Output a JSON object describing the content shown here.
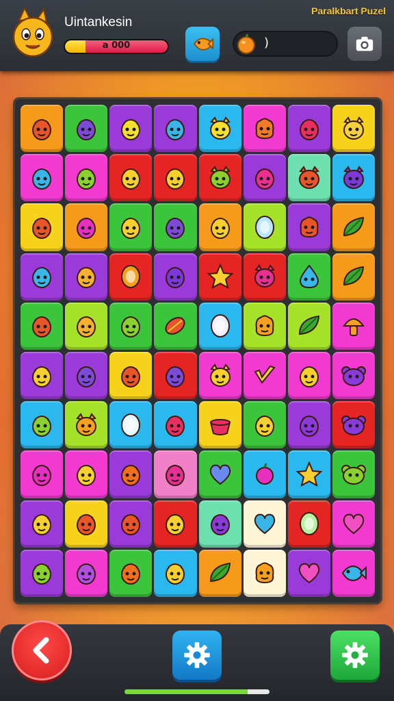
{
  "header": {
    "player_name": "Uintankesin",
    "score": "a 000",
    "score_progress": 0.2,
    "timer": ")",
    "game_title": "Paralkbart Puzel"
  },
  "icons": {
    "mascot": "cat-mascot-icon",
    "fish_button": "fish-icon",
    "timer": "fruit-timer-icon",
    "camera": "camera-icon",
    "back": "chevron-left-icon",
    "settings_blue": "gear-icon",
    "settings_green": "gear-icon"
  },
  "colors": {
    "topbar": "#2b2f35",
    "board": "#2e2f33",
    "accent_red": "#e02020",
    "accent_blue": "#1d8fd0",
    "accent_green": "#1ea83a"
  },
  "board": {
    "rows": 10,
    "cols": 8,
    "tiles": [
      [
        "orange:face:#e8552a",
        "green:face:#7b4bd8",
        "purple:face:#f2e030",
        "purple:face:#3ab5e8",
        "cyan:cat:#f5e030",
        "pink:blob:#f07a2a",
        "purple:face:#e83060",
        "yellow:cat:#f5d040"
      ],
      [
        "pink:face:#3ab5e8",
        "pink:face:#8ad030",
        "red:face:#f5d030",
        "red:face:#f5d030",
        "red:cat:#8ad030",
        "purple:face:#e83090",
        "mint:cat:#e8552a",
        "cyan:cat:#7b3ad8"
      ],
      [
        "yellow:face:#e8552a",
        "orange:face:#e830c0",
        "green:face:#f5d030",
        "green:face:#7b4bd8",
        "orange:face:#f5d030",
        "lime:egg:#b8e8f8",
        "purple:blob:#e8552a",
        "orange:leaf:#3aa830"
      ],
      [
        "purple:face:#3ab5e8",
        "purple:face:#f5b030",
        "red:egg:#f5a020",
        "purple:face:#7b3ad8",
        "red:star:#f5d030",
        "red:cat:#e83090",
        "green:drop:#3ab5e8",
        "orange:leaf:#3aa830"
      ],
      [
        "green:face:#e8552a",
        "lime:face:#f5b030",
        "green:face:#8ad030",
        "green:seed:#e8552a",
        "cyan:egg:#f0f0ff",
        "lime:blob:#f5a020",
        "lime:leaf:#3aa830",
        "pink:mush:#f5a020"
      ],
      [
        "purple:face:#f5d030",
        "purple:face:#7b4bd8",
        "yellow:face:#e8552a",
        "red:face:#7b4bd8",
        "pink:cat:#f5d030",
        "pink:check:#f5d030",
        "pink:face:#f5d030",
        "pink:bear:#8a3ad8"
      ],
      [
        "cyan:face:#8ad030",
        "lime:cat:#f5a020",
        "cyan:egg:#e8f8ff",
        "cyan:face:#e83060",
        "yellow:pot:#e83060",
        "green:face:#f5d030",
        "purple:face:#8a3ad8",
        "red:bear:#8a3ad8"
      ],
      [
        "pink:face:#e830c0",
        "pink:face:#f5d030",
        "purple:face:#f07020",
        "rose:face:#e83090",
        "green:heart:#6a8af0",
        "cyan:apple:#e830c0",
        "cyan:star:#f5d030",
        "green:bear:#8ad030"
      ],
      [
        "purple:face:#f5d030",
        "yellow:face:#e8552a",
        "purple:face:#e8552a",
        "red:face:#f5d030",
        "mint:face:#8a3ad8",
        "cream:heart:#3ab5e8",
        "red:egg:#b8f0a0",
        "pink:heart:#f050c0"
      ],
      [
        "purple:face:#8ad030",
        "pink:face:#b050e0",
        "green:face:#f07020",
        "cyan:face:#f5d030",
        "orange:leaf:#3aa830",
        "cream:blob:#f5a020",
        "purple:heart:#f050c0",
        "pink:fish:#3ab5e8"
      ]
    ]
  },
  "bottom": {
    "back_label": "",
    "settings_label": "",
    "options_label": ""
  }
}
